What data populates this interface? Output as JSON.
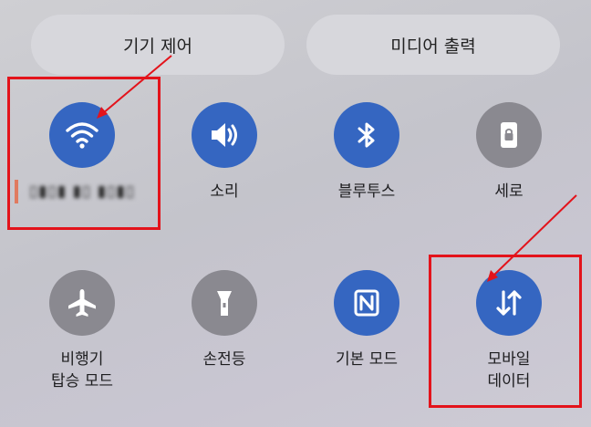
{
  "top_buttons": {
    "device_control": "기기 제어",
    "media_output": "미디어 출력"
  },
  "tiles": {
    "wifi": {
      "label": "▯▮▯▮ ▮▯ ▮▯▮▯",
      "state": "on",
      "icon": "wifi-icon"
    },
    "sound": {
      "label": "소리",
      "state": "on",
      "icon": "speaker-icon"
    },
    "bluetooth": {
      "label": "블루투스",
      "state": "on",
      "icon": "bluetooth-icon"
    },
    "rotation": {
      "label": "세로",
      "state": "off",
      "icon": "portrait-lock-icon"
    },
    "airplane": {
      "line1": "비행기",
      "line2": "탑승 모드",
      "state": "off",
      "icon": "airplane-icon"
    },
    "flashlight": {
      "label": "손전등",
      "state": "off",
      "icon": "flashlight-icon"
    },
    "nfc_mode": {
      "label": "기본 모드",
      "state": "on",
      "icon": "nfc-icon"
    },
    "mobile_data": {
      "line1": "모바일",
      "line2": "데이터",
      "state": "on",
      "icon": "data-arrows-icon"
    }
  },
  "colors": {
    "active": "#3566c1",
    "inactive": "#8a8990",
    "annotation": "#e3131b"
  }
}
